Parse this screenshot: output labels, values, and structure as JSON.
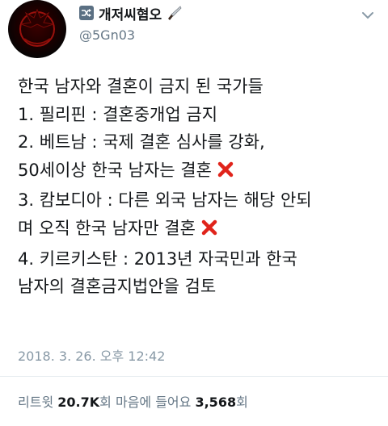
{
  "profile": {
    "display_name": "개저씨혐오",
    "handle": "@5Gn03"
  },
  "tweet": {
    "lines": [
      "한국 남자와 결혼이 금지 된 국가들",
      "1. 필리핀 : 결혼중개업 금지",
      "2. 베트남 : 국제 결혼 심사를 강화,",
      "50세이상 한국 남자는 결혼",
      "3. 캄보디아 : 다른 외국 남자는 해당 안되",
      "며 오직 한국 남자만 결혼",
      "4. 키르키스탄 : 2013년 자국민과 한국",
      "남자의 결혼금지법안을 검토"
    ],
    "timestamp": "2018. 3. 26. 오후 12:42"
  },
  "stats": {
    "retweet_label": "리트윗",
    "retweet_count": "20.7K",
    "retweet_unit": "회",
    "like_label": "마음에 들어요",
    "like_count": "3,568",
    "like_unit": "회"
  },
  "icons": {
    "cross_color": "#e0241b",
    "shuffle_bg": "#5b7083"
  }
}
